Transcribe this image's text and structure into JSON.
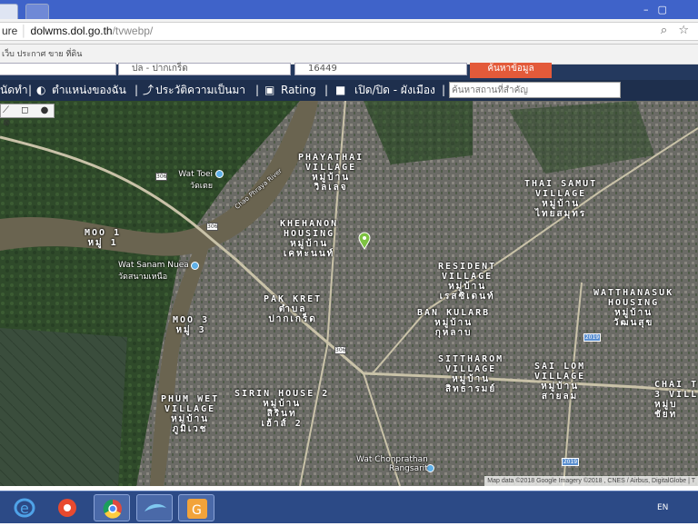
{
  "browser": {
    "url_prefix": "ure",
    "url_host": "dolwms.dol.go.th",
    "url_path": "/tvwebp/",
    "bookmarks_text": "เว็บ ประกาศ ขาย ที่ดิน",
    "url_icons": "⌕ ☆"
  },
  "search": {
    "field1": "ปล - ปากเกร็ด",
    "field2": "16449",
    "button": "ค้นหาข้อมูล"
  },
  "nav": {
    "home": "นัดทำ",
    "location": "ตำแหน่งของฉัน",
    "history": "ประวัติความเป็นมา",
    "rating": "Rating",
    "toggle": "เปิด/ปิด - ผังเมือง",
    "poi_placeholder": "ค้นหาสถานที่สำคัญ"
  },
  "map": {
    "tools": "⟋ ◻ ● ⊗",
    "labels": [
      {
        "text": "PHAYATHAI\nVILLAGE\nหมู่บ้าน\nวิลเลจ"
      },
      {
        "text": "THAI SAMUT\nVILLAGE\nหมู่บ้าน\nไทยสมุทร"
      },
      {
        "text": "KHEHANON\nHOUSING\nหมู่บ้าน\nเคหะนนท์"
      },
      {
        "text": "RESIDENT\nVILLAGE\nหมู่บ้าน\nเรสซิเดนท์"
      },
      {
        "text": "WATTHANASUK\nHOUSING\nหมู่บ้าน\nวัฒนสุข"
      },
      {
        "text": "PAK KRET\nตำบล\nปากเกร็ด"
      },
      {
        "text": "BAN KULARB\nหมู่บ้าน\nกุหลาบ"
      },
      {
        "text": "MOO 1\nหมู่ 1"
      },
      {
        "text": "MOO 3\nหมู่ 3"
      },
      {
        "text": "SITTHAROM\nVILLAGE\nหมู่บ้าน\nสิทธารมย์"
      },
      {
        "text": "SAI LOM\nVILLAGE\nหมู่บ้าน\nสายลม"
      },
      {
        "text": "CHAI T\n3 VILL\nหมู่บ\nชัยท"
      },
      {
        "text": "SIRIN HOUSE 2\nหมู่บ้าน\nสิรินท\nเฮ้าส์ 2"
      },
      {
        "text": "PHUM WET\nVILLAGE\nหมู่บ้าน\nภูมิเวช"
      }
    ],
    "pois": [
      {
        "text": "Wat Toei\nวัดเตย"
      },
      {
        "text": "Wat Sanam Nuea\nวัดสนามเหนือ"
      },
      {
        "text": "Wat Chonprathan\nRangsarit"
      }
    ],
    "river_label": "Chao Phraya River",
    "road_shield": "306",
    "road_shield_blue": "2019",
    "credit": "Map data ©2018 Google Imagery ©2018 , CNES / Airbus, DigitalGlobe | T"
  },
  "taskbar": {
    "lang": "EN"
  },
  "colors": {
    "tabbar": "#3f63c9",
    "navbar": "#1e2f4d",
    "search_button": "#e35a3a",
    "taskbar": "#2c4a86"
  }
}
